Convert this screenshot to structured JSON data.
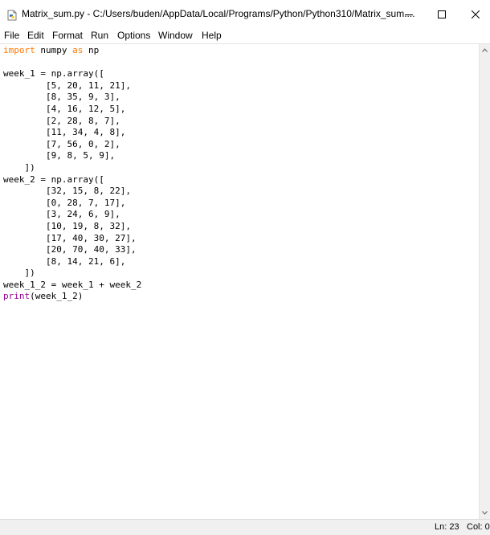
{
  "window": {
    "title": "Matrix_sum.py - C:/Users/buden/AppData/Local/Programs/Python/Python310/Matrix_sum....",
    "icons": [
      "python-file-icon",
      "minimize-icon",
      "maximize-icon",
      "close-icon"
    ]
  },
  "menu": [
    "File",
    "Edit",
    "Format",
    "Run",
    "Options",
    "Window",
    "Help"
  ],
  "code": {
    "lines": [
      [
        {
          "t": "import",
          "c": "kw"
        },
        {
          "t": " numpy "
        },
        {
          "t": "as",
          "c": "kw"
        },
        {
          "t": " np"
        }
      ],
      [],
      [
        {
          "t": "week_1 = np.array(["
        }
      ],
      [
        {
          "t": "        [5, 20, 11, 21],"
        }
      ],
      [
        {
          "t": "        [8, 35, 9, 3],"
        }
      ],
      [
        {
          "t": "        [4, 16, 12, 5],"
        }
      ],
      [
        {
          "t": "        [2, 28, 8, 7],"
        }
      ],
      [
        {
          "t": "        [11, 34, 4, 8],"
        }
      ],
      [
        {
          "t": "        [7, 56, 0, 2],"
        }
      ],
      [
        {
          "t": "        [9, 8, 5, 9],"
        }
      ],
      [
        {
          "t": "    ])"
        }
      ],
      [
        {
          "t": "week_2 = np.array(["
        }
      ],
      [
        {
          "t": "        [32, 15, 8, 22],"
        }
      ],
      [
        {
          "t": "        [0, 28, 7, 17],"
        }
      ],
      [
        {
          "t": "        [3, 24, 6, 9],"
        }
      ],
      [
        {
          "t": "        [10, 19, 8, 32],"
        }
      ],
      [
        {
          "t": "        [17, 40, 30, 27],"
        }
      ],
      [
        {
          "t": "        [20, 70, 40, 33],"
        }
      ],
      [
        {
          "t": "        [8, 14, 21, 6],"
        }
      ],
      [
        {
          "t": "    ])"
        }
      ],
      [
        {
          "t": "week_1_2 = week_1 + week_2"
        }
      ],
      [
        {
          "t": "print",
          "c": "bi"
        },
        {
          "t": "(week_1_2)"
        }
      ]
    ]
  },
  "status": {
    "line": "Ln: 23",
    "col": "Col: 0"
  },
  "colors": {
    "keyword": "#ff7700",
    "builtin": "#900090"
  }
}
